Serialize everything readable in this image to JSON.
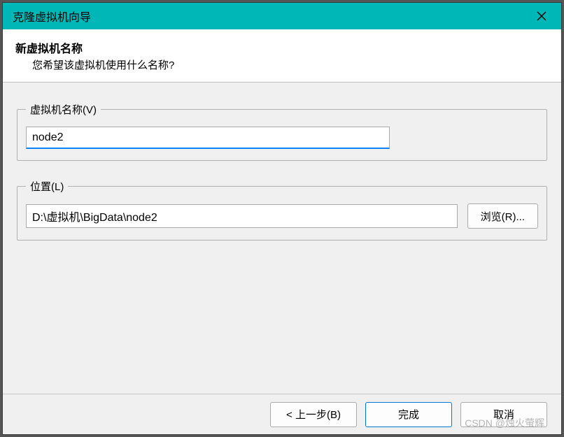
{
  "titlebar": {
    "title": "克隆虚拟机向导"
  },
  "header": {
    "title": "新虚拟机名称",
    "subtitle": "您希望该虚拟机使用什么名称?"
  },
  "form": {
    "name_group_label": "虚拟机名称(V)",
    "name_value": "node2",
    "location_group_label": "位置(L)",
    "location_value": "D:\\虚拟机\\BigData\\node2",
    "browse_label": "浏览(R)..."
  },
  "footer": {
    "back_label": "< 上一步(B)",
    "finish_label": "完成",
    "cancel_label": "取消"
  },
  "watermark": "CSDN @烛火萤辉"
}
